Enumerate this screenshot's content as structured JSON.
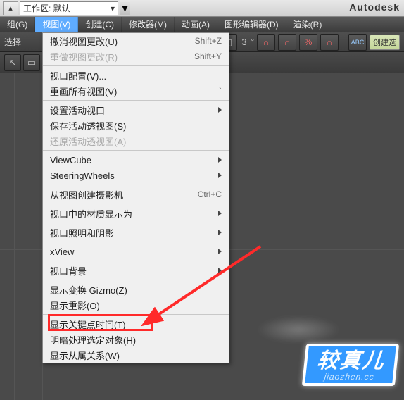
{
  "topbar": {
    "workspace_label": "工作区: 默认",
    "brand": "Autodesk"
  },
  "menubar": {
    "items": [
      {
        "label": "组(G)"
      },
      {
        "label": "视图(V)"
      },
      {
        "label": "创建(C)"
      },
      {
        "label": "修改器(M)"
      },
      {
        "label": "动画(A)"
      },
      {
        "label": "图形编辑器(D)"
      },
      {
        "label": "渲染(R)"
      }
    ]
  },
  "toolbar": {
    "select_label": "选择",
    "angle_hint": "3",
    "create_label": "创建选"
  },
  "dropdown": {
    "items": [
      {
        "label": "撤消视图更改(U)",
        "shortcut": "Shift+Z",
        "submenu": false,
        "disabled": false
      },
      {
        "label": "重做视图更改(R)",
        "shortcut": "Shift+Y",
        "submenu": false,
        "disabled": true
      },
      {
        "sep": true
      },
      {
        "label": "视口配置(V)...",
        "submenu": false,
        "disabled": false
      },
      {
        "label": "重画所有视图(V)",
        "shortcut": "`",
        "submenu": false,
        "disabled": false
      },
      {
        "sep": true
      },
      {
        "label": "设置活动视口",
        "submenu": true,
        "disabled": false
      },
      {
        "label": "保存活动透视图(S)",
        "submenu": false,
        "disabled": false
      },
      {
        "label": "还原活动透视图(A)",
        "submenu": false,
        "disabled": true
      },
      {
        "sep": true
      },
      {
        "label": "ViewCube",
        "submenu": true,
        "disabled": false
      },
      {
        "label": "SteeringWheels",
        "submenu": true,
        "disabled": false
      },
      {
        "sep": true
      },
      {
        "label": "从视图创建摄影机",
        "shortcut": "Ctrl+C",
        "submenu": false,
        "disabled": false
      },
      {
        "sep": true
      },
      {
        "label": "视口中的材质显示为",
        "submenu": true,
        "disabled": false
      },
      {
        "sep": true
      },
      {
        "label": "视口照明和阴影",
        "submenu": true,
        "disabled": false
      },
      {
        "sep": true
      },
      {
        "label": "xView",
        "submenu": true,
        "disabled": false
      },
      {
        "sep": true
      },
      {
        "label": "视口背景",
        "submenu": true,
        "disabled": false
      },
      {
        "sep": true
      },
      {
        "label": "显示变换 Gizmo(Z)",
        "submenu": false,
        "disabled": false
      },
      {
        "label": "显示重影(O)",
        "submenu": false,
        "disabled": false
      },
      {
        "sep": true
      },
      {
        "label": "显示关键点时间(T)",
        "submenu": false,
        "disabled": false
      },
      {
        "label": "明暗处理选定对象(H)",
        "submenu": false,
        "disabled": false
      },
      {
        "label": "显示从属关系(W)",
        "submenu": false,
        "disabled": false
      }
    ]
  },
  "watermark": {
    "main": "较真儿",
    "sub": "jiaozhen.cc"
  }
}
